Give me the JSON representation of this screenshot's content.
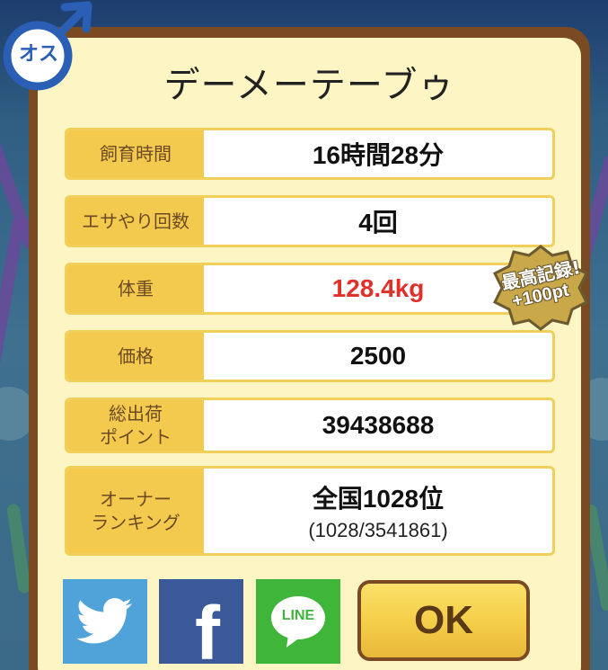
{
  "title": "デーメーテーブゥ",
  "sex": {
    "label": "オス",
    "icon": "male-symbol-icon",
    "color": "#2a5fb5"
  },
  "stats": [
    {
      "label": "飼育時間",
      "value": "16時間28分"
    },
    {
      "label": "エサやり回数",
      "value": "4回"
    },
    {
      "label": "体重",
      "value": "128.4kg"
    },
    {
      "label": "価格",
      "value": "2500"
    },
    {
      "label": "総出荷\nポイント",
      "value": "39438688"
    },
    {
      "label": "オーナー\nランキング",
      "value": "全国1028位",
      "sub": "(1028/3541861)"
    }
  ],
  "record_badge": {
    "line1": "最高記録!",
    "line2": "+100pt"
  },
  "buttons": {
    "ok": "OK",
    "share": [
      {
        "name": "twitter",
        "icon": "twitter-bird-icon",
        "color": "#4fa3d9"
      },
      {
        "name": "facebook",
        "icon": "facebook-f-icon",
        "color": "#3b5998",
        "glyph": "f"
      },
      {
        "name": "line",
        "icon": "line-icon",
        "color": "#3fb53a",
        "text": "LINE"
      }
    ]
  },
  "colors": {
    "label_bg": "#f3c94e",
    "panel_bg": "#fdf6c4",
    "frame": "#7a4a22",
    "highlight_value": "#e0302a"
  }
}
